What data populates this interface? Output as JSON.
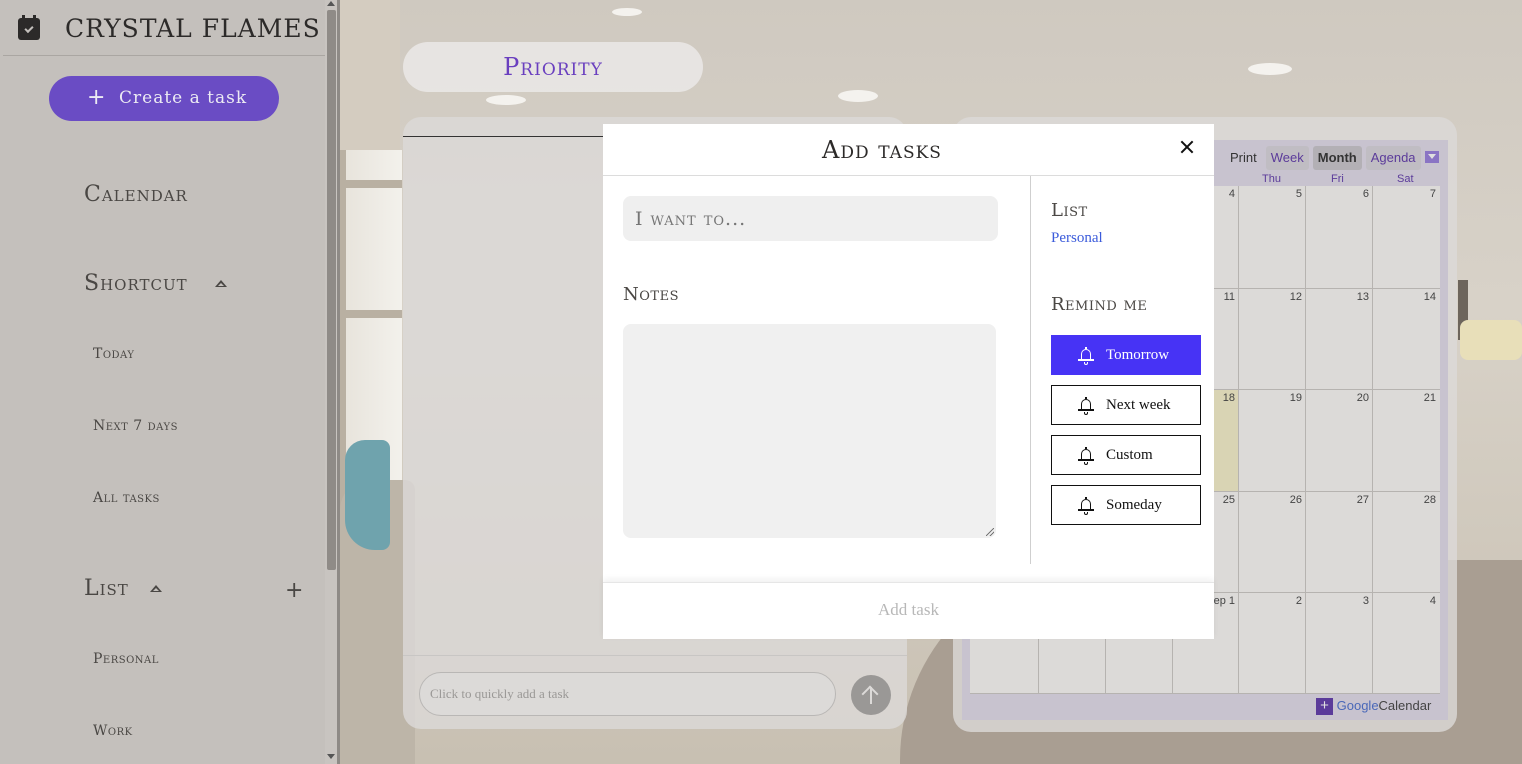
{
  "brand": {
    "title": "CRYSTAL FLAMES",
    "icon": "calendar-check-icon"
  },
  "sidebar": {
    "create_label": "Create a task",
    "calendar_heading": "Calendar",
    "shortcut_heading": "Shortcut",
    "shortcut_items": [
      "Today",
      "Next 7 days",
      "All tasks"
    ],
    "list_heading": "List",
    "list_items": [
      "Personal",
      "Work"
    ]
  },
  "main": {
    "priority_label": "Priority",
    "quick_add_placeholder": "Click to quickly add a task"
  },
  "calendar": {
    "toolbar": {
      "print": "Print",
      "week": "Week",
      "month": "Month",
      "agenda": "Agenda"
    },
    "days": [
      "Thu",
      "Fri",
      "Sat"
    ],
    "row_numbers": [
      [
        "4",
        "5",
        "6",
        "7"
      ],
      [
        "11",
        "12",
        "13",
        "14"
      ],
      [
        "18",
        "19",
        "20",
        "21"
      ],
      [
        "25",
        "26",
        "27",
        "28"
      ],
      [
        "ep 1",
        "2",
        "3",
        "4"
      ]
    ],
    "footer_label": "Calendar",
    "footer_brand": "Google"
  },
  "modal": {
    "title": "Add tasks",
    "task_placeholder": "I want to...",
    "notes_label": "Notes",
    "list_label": "List",
    "list_value": "Personal",
    "remind_label": "Remind me",
    "remind_options": [
      "Tomorrow",
      "Next week",
      "Custom",
      "Someday"
    ],
    "selected_remind": "Tomorrow",
    "add_task_label": "Add task"
  },
  "colors": {
    "accent": "#6a4cc4",
    "selected": "#4733f5",
    "list_link": "#3b5bdb",
    "priority_text": "#6a3fbf"
  }
}
